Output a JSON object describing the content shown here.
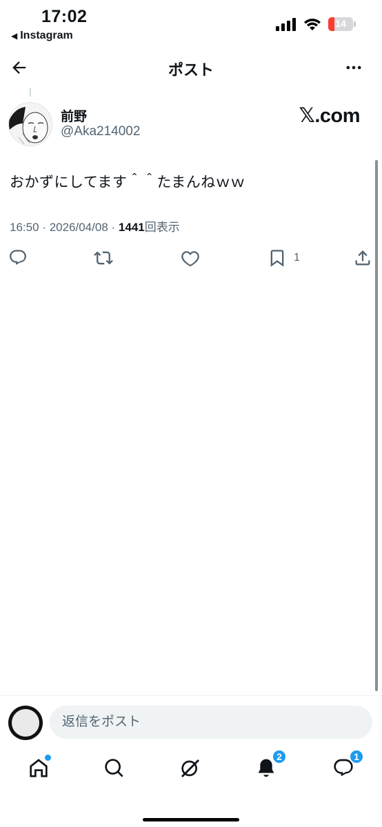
{
  "status_bar": {
    "time": "17:02",
    "back_app": "Instagram",
    "battery_level": "14",
    "battery_color": "#ff3b30"
  },
  "header": {
    "title": "ポスト",
    "back_icon": "arrow-left-icon",
    "more_icon": "more-horizontal-icon"
  },
  "post": {
    "author_name": "前野",
    "author_handle": "@Aka214002",
    "brand_x": "𝕏",
    "brand_com": ".com",
    "text": "おかずにしてます＾＾たまんねｗｗ",
    "time": "16:50",
    "separator": "·",
    "date": "2026/04/08",
    "views": "1441",
    "views_label": "回表示",
    "bookmark_count": "1"
  },
  "actions": [
    "reply-icon",
    "repost-icon",
    "like-icon",
    "bookmark-icon",
    "share-icon"
  ],
  "reply_bar": {
    "placeholder": "返信をポスト"
  },
  "tab_bar": {
    "notifications_badge": "2",
    "messages_badge": "1",
    "accent_color": "#1d9bf0"
  }
}
